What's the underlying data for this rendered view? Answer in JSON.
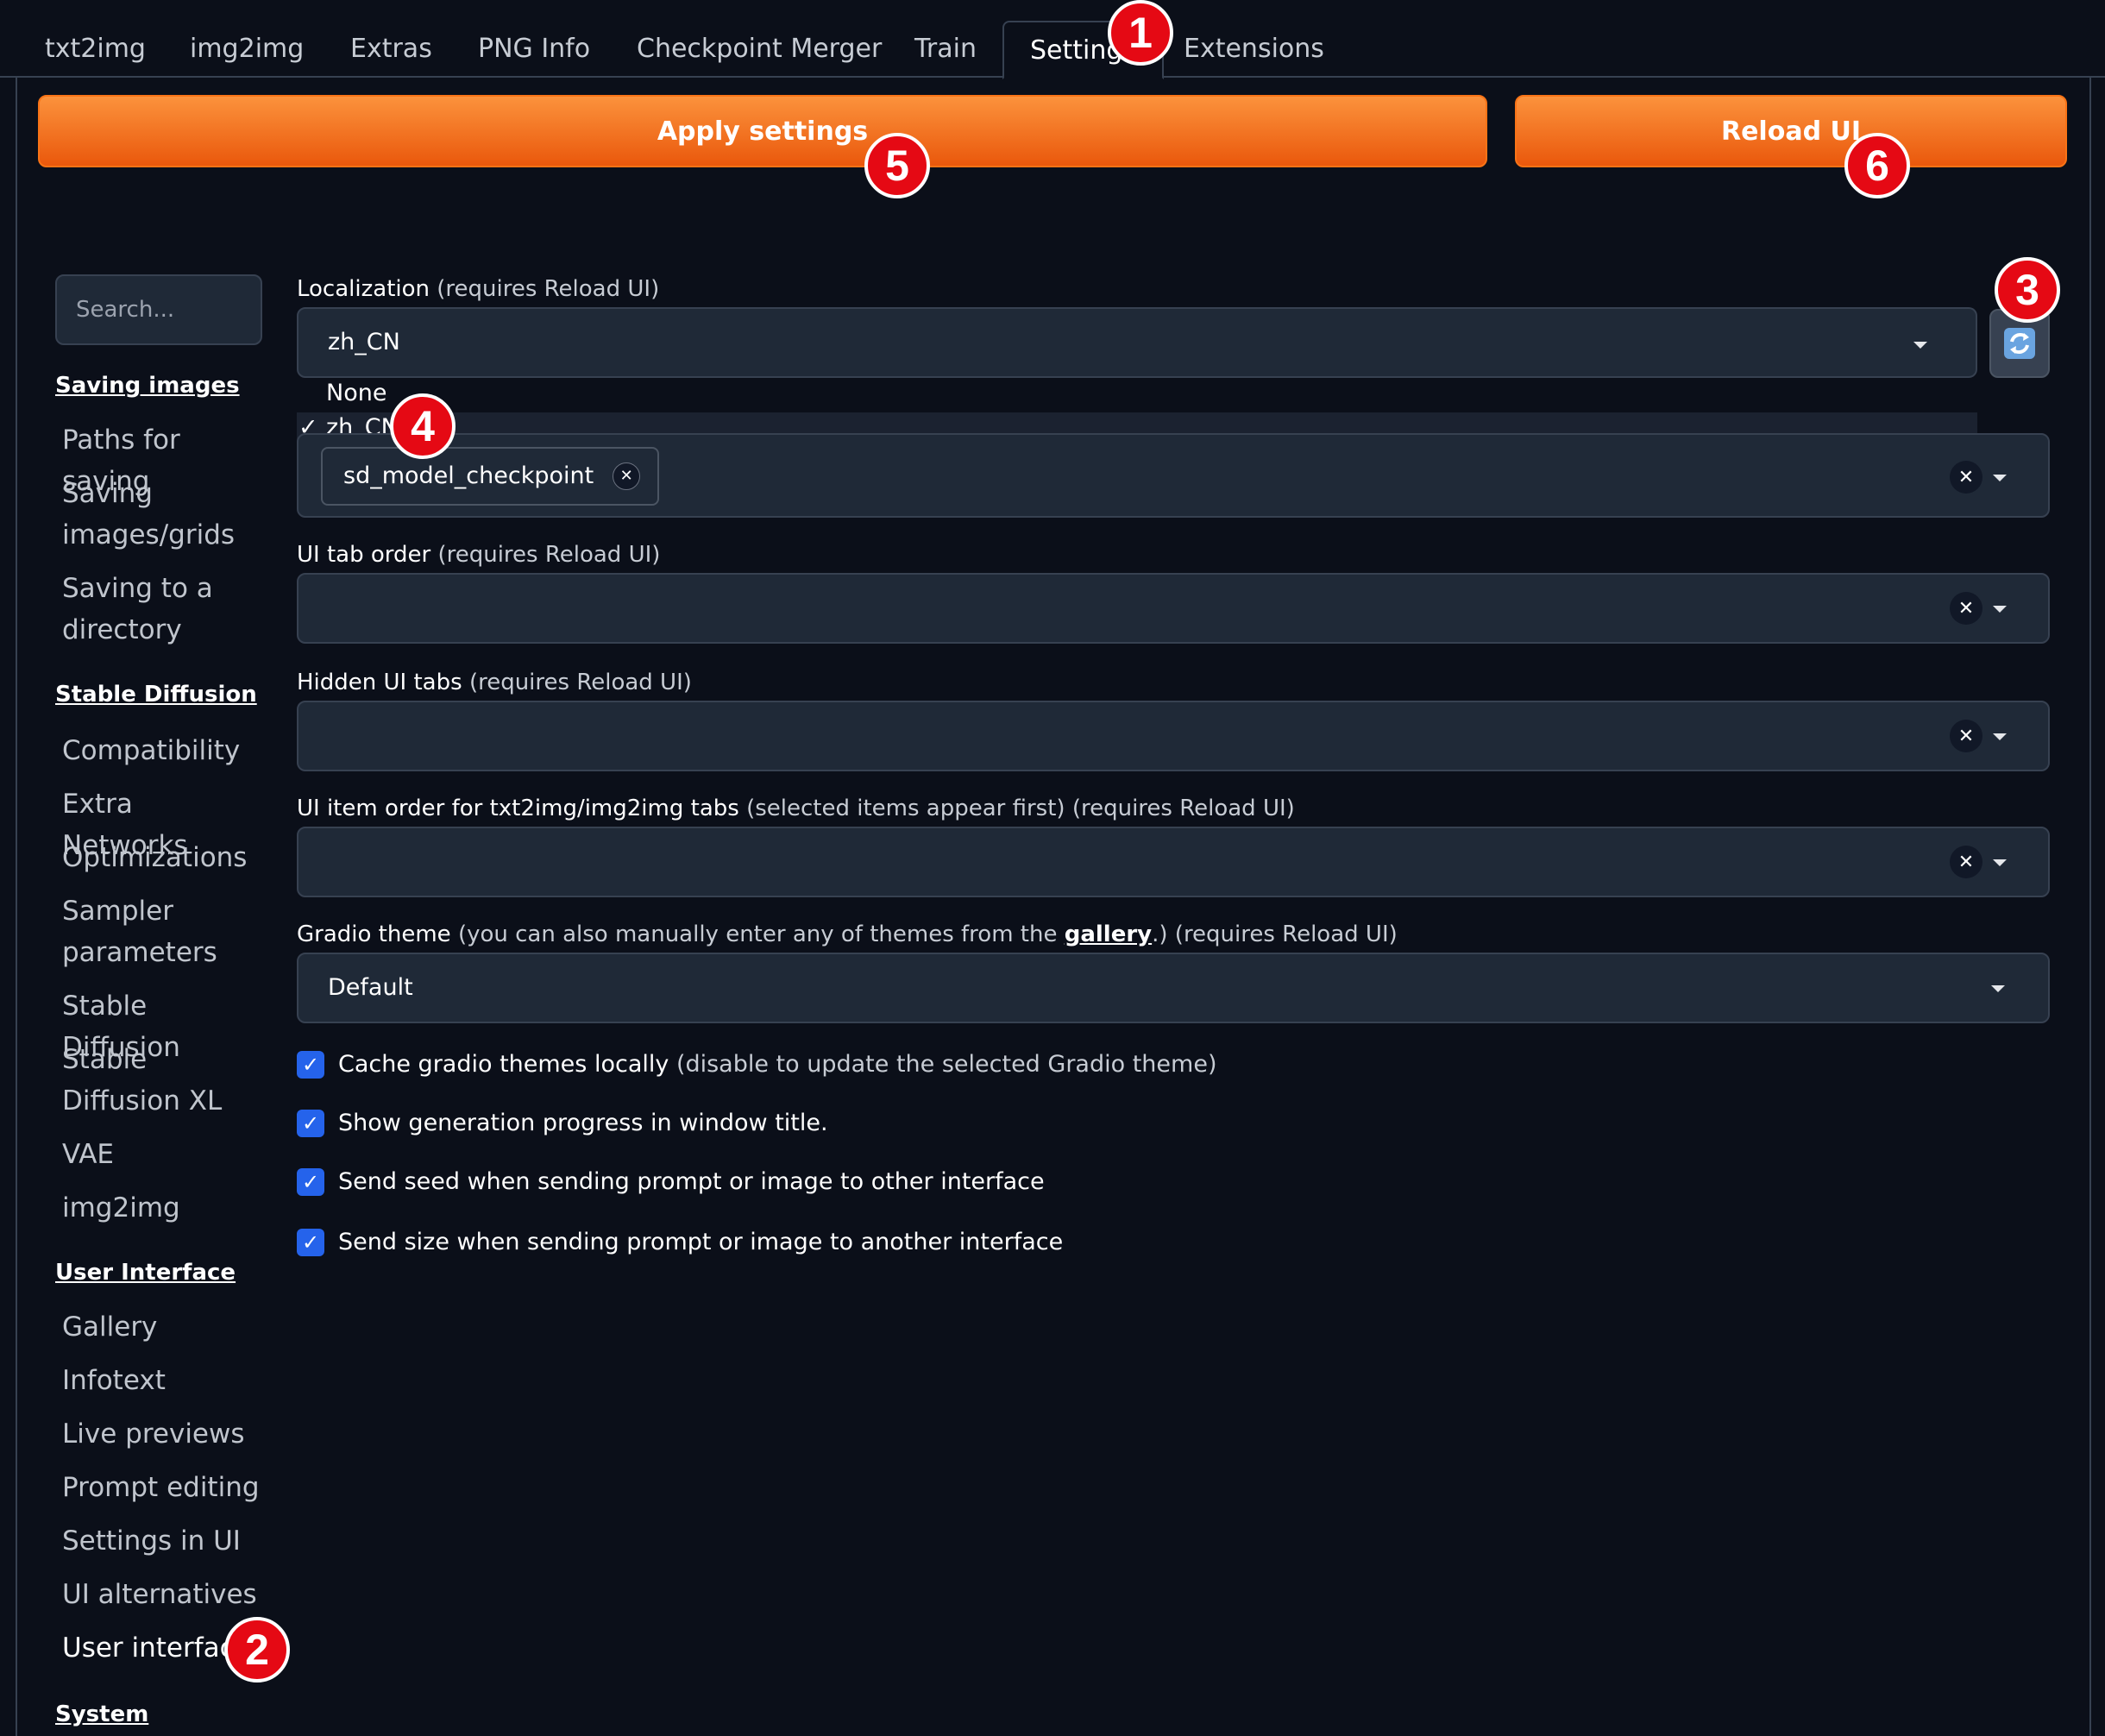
{
  "tabs": [
    {
      "label": "txt2img"
    },
    {
      "label": "img2img"
    },
    {
      "label": "Extras"
    },
    {
      "label": "PNG Info"
    },
    {
      "label": "Checkpoint Merger"
    },
    {
      "label": "Train"
    },
    {
      "label": "Settings"
    },
    {
      "label": "Extensions"
    }
  ],
  "buttons": {
    "apply": "Apply settings",
    "reload": "Reload UI"
  },
  "sidebar": {
    "search_placeholder": "Search...",
    "sections": {
      "saving": "Saving images",
      "sd": "Stable Diffusion",
      "ui": "User Interface",
      "system": "System"
    },
    "items": [
      "Paths for saving",
      "Saving images/grids",
      "Saving to a directory",
      "Compatibility",
      "Extra Networks",
      "Optimizations",
      "Sampler parameters",
      "Stable Diffusion",
      "Stable Diffusion XL",
      "VAE",
      "img2img",
      "Gallery",
      "Infotext",
      "Live previews",
      "Prompt editing",
      "Settings in UI",
      "UI alternatives",
      "User interface"
    ]
  },
  "settings": {
    "localization": {
      "label": "Localization",
      "note": "(requires Reload UI)",
      "value": "zh_CN",
      "options": [
        "None",
        "zh_CN"
      ]
    },
    "quicksettings": {
      "chip": "sd_model_checkpoint"
    },
    "tab_order": {
      "label": "UI tab order",
      "note": "(requires Reload UI)"
    },
    "hidden_tabs": {
      "label": "Hidden UI tabs",
      "note": "(requires Reload UI)"
    },
    "item_order": {
      "label": "UI item order for txt2img/img2img tabs",
      "note": "(selected items appear first) (requires Reload UI)"
    },
    "theme": {
      "label": "Gradio theme",
      "note_a": "(you can also manually enter any of themes from the",
      "link": "gallery",
      "note_b": ".) (requires Reload UI)",
      "value": "Default"
    },
    "checkboxes": [
      {
        "label": "Cache gradio themes locally",
        "note": "(disable to update the selected Gradio theme)",
        "checked": true
      },
      {
        "label": "Show generation progress in window title.",
        "note": "",
        "checked": true
      },
      {
        "label": "Send seed when sending prompt or image to other interface",
        "note": "",
        "checked": true
      },
      {
        "label": "Send size when sending prompt or image to another interface",
        "note": "",
        "checked": true
      }
    ]
  },
  "markers": [
    "1",
    "2",
    "3",
    "4",
    "5",
    "6"
  ],
  "colors": {
    "background": "#0b0f19",
    "field": "#1f2937",
    "accent_orange": "#f97316",
    "checkbox_blue": "#2563eb",
    "marker_red": "#e50914"
  }
}
